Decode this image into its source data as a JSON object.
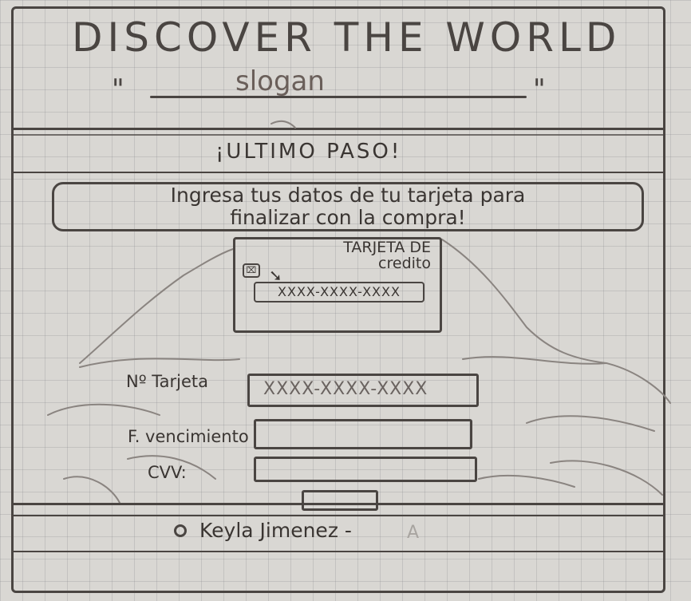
{
  "header": {
    "title": "DISCOVER THE WORLD",
    "slogan": "slogan",
    "quote_open": "\"",
    "quote_close": "\""
  },
  "checkout": {
    "step_title": "¡ULTIMO PASO!",
    "instructions_line1": "Ingresa tus datos de tu tarjeta para",
    "instructions_line2": "finalizar con la compra!",
    "card_preview": {
      "title_line1": "TARJETA DE",
      "title_line2": "credito",
      "chip": "⌧",
      "number": "XXXX-XXXX-XXXX"
    },
    "fields": {
      "card_number_label": "Nº Tarjeta",
      "card_number_placeholder": "XXXX-XXXX-XXXX",
      "expiry_label": "F. vencimiento",
      "cvv_label": "CVV:"
    }
  },
  "footer": {
    "author": "Keyla Jimenez -"
  }
}
